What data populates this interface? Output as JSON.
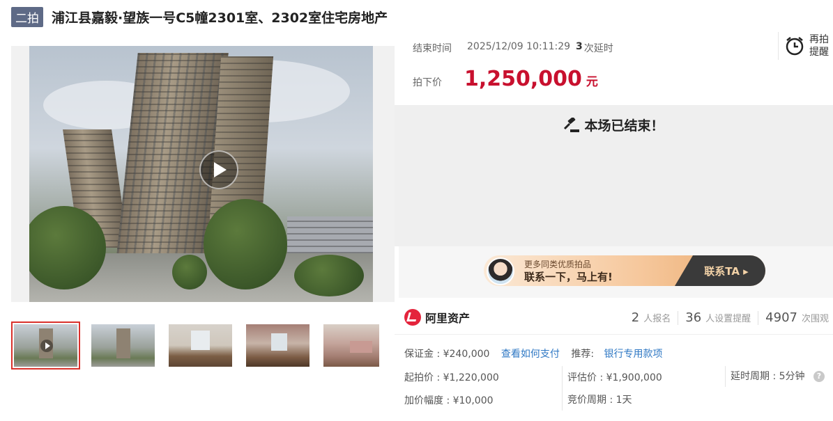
{
  "header": {
    "badge": "二拍",
    "title": "浦江县嘉毅·望族一号C5幢2301室、2302室住宅房地产"
  },
  "auction": {
    "end_label": "结束时间",
    "end_time": "2025/12/09 10:11:29",
    "delay_count": "3",
    "delay_suffix": "次延时",
    "deal_label": "拍下价",
    "deal_price": "1,250,000",
    "deal_unit": "元",
    "remind_line1": "再拍",
    "remind_line2": "提醒",
    "ended_text": "本场已结束！"
  },
  "promo": {
    "line1": "更多同类优质拍品",
    "line2": "联系一下，马上有!",
    "cta": "联系TA ▸"
  },
  "stats": {
    "brand": "阿里资产",
    "signups": "2",
    "signups_label": "人报名",
    "reminders": "36",
    "reminders_label": "人设置提醒",
    "views": "4907",
    "views_label": "次围观"
  },
  "details": {
    "deposit": "保证金 : ¥240,000",
    "pay_link": "查看如何支付",
    "recommend_label": "推荐:",
    "recommend_link": "银行专用款项",
    "start_price": "起拍价 : ¥1,220,000",
    "appraisal": "评估价 : ¥1,900,000",
    "delay_period": "延时周期 : 5分钟",
    "increment": "加价幅度 : ¥10,000",
    "bid_period": "竞价周期 : 1天"
  }
}
